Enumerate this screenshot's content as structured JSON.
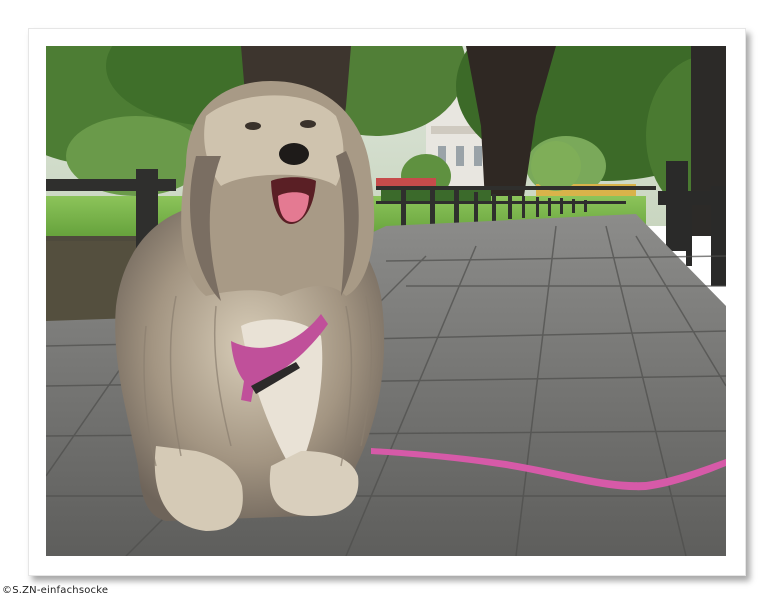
{
  "photo": {
    "subject": "dog-icon",
    "credit": "©S.ZN-einfachsocke"
  },
  "colors": {
    "pavement": "#6e6e6e",
    "grass": "#6fae3e",
    "foliage": "#3f6f2a",
    "fur": "#b8aa96",
    "harness": "#c0509a",
    "leash": "#d65aa8"
  }
}
